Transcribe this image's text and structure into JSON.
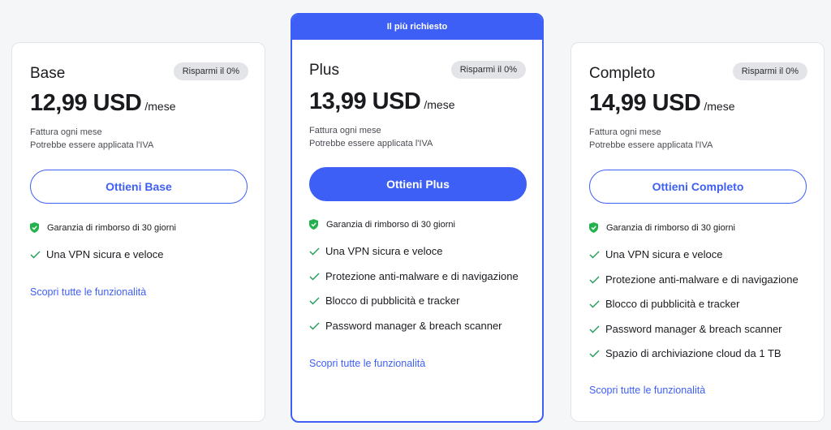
{
  "colors": {
    "accent": "#3e5ff5",
    "check": "#1f9d55",
    "shield": "#23b14d",
    "badge_bg": "#e3e4e8"
  },
  "plans": [
    {
      "name": "Base",
      "badge": "Risparmi il 0%",
      "price": "12,99 USD",
      "period": "/mese",
      "billing": "Fattura ogni mese",
      "vat": "Potrebbe essere applicata l'IVA",
      "cta": "Ottieni Base",
      "guarantee": "Garanzia di rimborso di 30 giorni",
      "features": [
        "Una VPN sicura e veloce"
      ],
      "link": "Scopri tutte le funzionalità"
    },
    {
      "banner": "Il più richiesto",
      "name": "Plus",
      "badge": "Risparmi il 0%",
      "price": "13,99 USD",
      "period": "/mese",
      "billing": "Fattura ogni mese",
      "vat": "Potrebbe essere applicata l'IVA",
      "cta": "Ottieni Plus",
      "guarantee": "Garanzia di rimborso di 30 giorni",
      "features": [
        "Una VPN sicura e veloce",
        "Protezione anti-malware e di navigazione",
        "Blocco di pubblicità e tracker",
        "Password manager & breach scanner"
      ],
      "link": "Scopri tutte le funzionalità"
    },
    {
      "name": "Completo",
      "badge": "Risparmi il 0%",
      "price": "14,99 USD",
      "period": "/mese",
      "billing": "Fattura ogni mese",
      "vat": "Potrebbe essere applicata l'IVA",
      "cta": "Ottieni Completo",
      "guarantee": "Garanzia di rimborso di 30 giorni",
      "features": [
        "Una VPN sicura e veloce",
        "Protezione anti-malware e di navigazione",
        "Blocco di pubblicità e tracker",
        "Password manager & breach scanner",
        "Spazio di archiviazione cloud da 1 TB"
      ],
      "link": "Scopri tutte le funzionalità"
    }
  ]
}
